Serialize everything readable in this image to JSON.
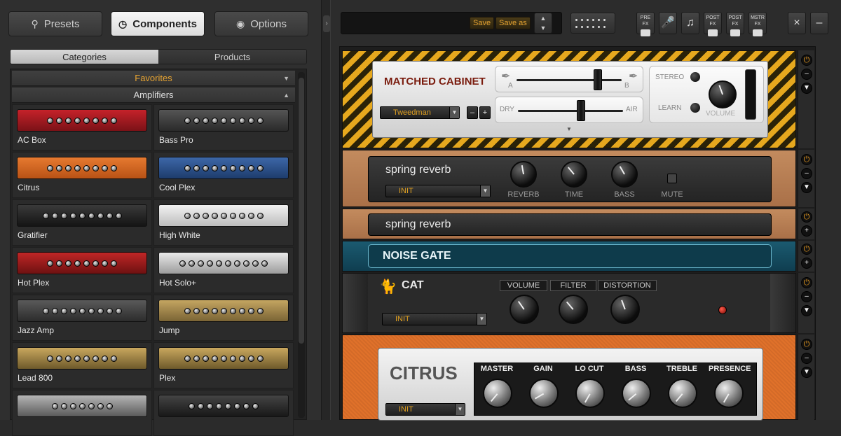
{
  "tabs": {
    "presets": "Presets",
    "components": "Components",
    "options": "Options"
  },
  "browser": {
    "segments": [
      "Categories",
      "Products"
    ],
    "favorites": "Favorites",
    "amplifiers": "Amplifiers",
    "items": [
      "AC Box",
      "Bass Pro",
      "Citrus",
      "Cool Plex",
      "Gratifier",
      "High White",
      "Hot Plex",
      "Hot Solo+",
      "Jazz Amp",
      "Jump",
      "Lead 800",
      "Plex"
    ]
  },
  "toolbar": {
    "save": "Save",
    "save_as": "Save as",
    "tools": [
      "PRE FX",
      "",
      "",
      "POST FX",
      "POST FX",
      "MSTR FX"
    ]
  },
  "cabinet": {
    "title": "MATCHED CABINET",
    "preset": "Tweedman",
    "mic_a": "A",
    "mic_b": "B",
    "dry": "DRY",
    "air": "AIR",
    "stereo": "STEREO",
    "learn": "LEARN",
    "volume": "VOLUME"
  },
  "spring1": {
    "title": "spring reverb",
    "preset": "INIT",
    "knobs": [
      "REVERB",
      "TIME",
      "BASS"
    ],
    "mute": "MUTE"
  },
  "spring2": {
    "title": "spring reverb"
  },
  "gate": {
    "title": "NOISE GATE"
  },
  "cat": {
    "title": "CAT",
    "preset": "INIT",
    "knobs": [
      "VOLUME",
      "FILTER",
      "DISTORTION"
    ]
  },
  "citrus": {
    "title": "CITRUS",
    "preset": "INIT",
    "knobs": [
      "MASTER",
      "GAIN",
      "LO CUT",
      "BASS",
      "TREBLE",
      "PRESENCE"
    ]
  },
  "colors": {
    "accent": "#e7a432",
    "cab_hatch": "#e6a81e",
    "gate_teal": "#1b5a70",
    "citrus_orange": "#e0712a"
  }
}
